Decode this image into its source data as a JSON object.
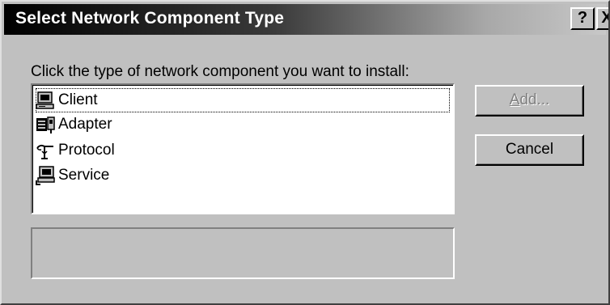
{
  "dialog": {
    "title": "Select Network Component Type",
    "help_glyph": "?",
    "close_glyph": "X"
  },
  "prompt": "Click the type of network component you want to install:",
  "components": [
    {
      "label": "Client",
      "icon": "computer-icon",
      "selected": true
    },
    {
      "label": "Adapter",
      "icon": "network-adapter-icon",
      "selected": false
    },
    {
      "label": "Protocol",
      "icon": "protocol-icon",
      "selected": false
    },
    {
      "label": "Service",
      "icon": "service-icon",
      "selected": false
    }
  ],
  "buttons": {
    "add_label": "Add...",
    "add_enabled": false,
    "cancel_label": "Cancel"
  },
  "description": ""
}
